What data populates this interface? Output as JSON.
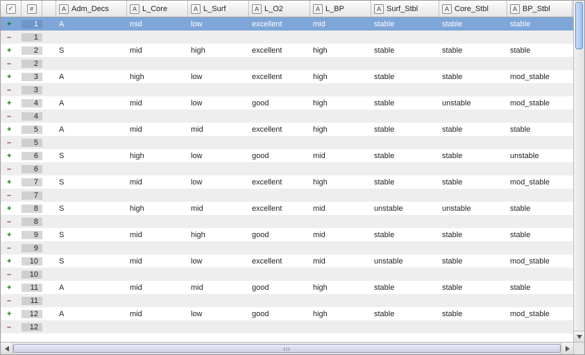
{
  "columns": {
    "adm": "Adm_Decs",
    "lcore": "L_Core",
    "lsurf": "L_Surf",
    "lo2": "L_O2",
    "lbp": "L_BP",
    "surfs": "Surf_Stbl",
    "cores": "Core_Stbl",
    "bps": "BP_Stbl"
  },
  "header_icons": {
    "check": "✓",
    "hash": "#",
    "text": "A"
  },
  "rows": [
    {
      "n": 1,
      "kind": "plus",
      "selected": true,
      "v": [
        "A",
        "mid",
        "low",
        "excellent",
        "mid",
        "stable",
        "stable",
        "stable"
      ]
    },
    {
      "n": 1,
      "kind": "minus",
      "selected": false,
      "v": [
        "",
        "",
        "",
        "",
        "",
        "",
        "",
        ""
      ]
    },
    {
      "n": 2,
      "kind": "plus",
      "selected": false,
      "v": [
        "S",
        "mid",
        "high",
        "excellent",
        "high",
        "stable",
        "stable",
        "stable"
      ]
    },
    {
      "n": 2,
      "kind": "minus",
      "selected": false,
      "v": [
        "",
        "",
        "",
        "",
        "",
        "",
        "",
        ""
      ]
    },
    {
      "n": 3,
      "kind": "plus",
      "selected": false,
      "v": [
        "A",
        "high",
        "low",
        "excellent",
        "high",
        "stable",
        "stable",
        "mod_stable"
      ]
    },
    {
      "n": 3,
      "kind": "minus",
      "selected": false,
      "v": [
        "",
        "",
        "",
        "",
        "",
        "",
        "",
        ""
      ]
    },
    {
      "n": 4,
      "kind": "plus",
      "selected": false,
      "v": [
        "A",
        "mid",
        "low",
        "good",
        "high",
        "stable",
        "unstable",
        "mod_stable"
      ]
    },
    {
      "n": 4,
      "kind": "minus",
      "selected": false,
      "v": [
        "",
        "",
        "",
        "",
        "",
        "",
        "",
        ""
      ]
    },
    {
      "n": 5,
      "kind": "plus",
      "selected": false,
      "v": [
        "A",
        "mid",
        "mid",
        "excellent",
        "high",
        "stable",
        "stable",
        "stable"
      ]
    },
    {
      "n": 5,
      "kind": "minus",
      "selected": false,
      "v": [
        "",
        "",
        "",
        "",
        "",
        "",
        "",
        ""
      ]
    },
    {
      "n": 6,
      "kind": "plus",
      "selected": false,
      "v": [
        "S",
        "high",
        "low",
        "good",
        "mid",
        "stable",
        "stable",
        "unstable"
      ]
    },
    {
      "n": 6,
      "kind": "minus",
      "selected": false,
      "v": [
        "",
        "",
        "",
        "",
        "",
        "",
        "",
        ""
      ]
    },
    {
      "n": 7,
      "kind": "plus",
      "selected": false,
      "v": [
        "S",
        "mid",
        "low",
        "excellent",
        "high",
        "stable",
        "stable",
        "mod_stable"
      ]
    },
    {
      "n": 7,
      "kind": "minus",
      "selected": false,
      "v": [
        "",
        "",
        "",
        "",
        "",
        "",
        "",
        ""
      ]
    },
    {
      "n": 8,
      "kind": "plus",
      "selected": false,
      "v": [
        "S",
        "high",
        "mid",
        "excellent",
        "mid",
        "unstable",
        "unstable",
        "stable"
      ]
    },
    {
      "n": 8,
      "kind": "minus",
      "selected": false,
      "v": [
        "",
        "",
        "",
        "",
        "",
        "",
        "",
        ""
      ]
    },
    {
      "n": 9,
      "kind": "plus",
      "selected": false,
      "v": [
        "S",
        "mid",
        "high",
        "good",
        "mid",
        "stable",
        "stable",
        "stable"
      ]
    },
    {
      "n": 9,
      "kind": "minus",
      "selected": false,
      "v": [
        "",
        "",
        "",
        "",
        "",
        "",
        "",
        ""
      ]
    },
    {
      "n": 10,
      "kind": "plus",
      "selected": false,
      "v": [
        "S",
        "mid",
        "low",
        "excellent",
        "mid",
        "unstable",
        "stable",
        "mod_stable"
      ]
    },
    {
      "n": 10,
      "kind": "minus",
      "selected": false,
      "v": [
        "",
        "",
        "",
        "",
        "",
        "",
        "",
        ""
      ]
    },
    {
      "n": 11,
      "kind": "plus",
      "selected": false,
      "v": [
        "A",
        "mid",
        "mid",
        "good",
        "high",
        "stable",
        "stable",
        "stable"
      ]
    },
    {
      "n": 11,
      "kind": "minus",
      "selected": false,
      "v": [
        "",
        "",
        "",
        "",
        "",
        "",
        "",
        ""
      ]
    },
    {
      "n": 12,
      "kind": "plus",
      "selected": false,
      "v": [
        "A",
        "mid",
        "low",
        "good",
        "high",
        "stable",
        "stable",
        "mod_stable"
      ]
    },
    {
      "n": 12,
      "kind": "minus",
      "selected": false,
      "v": [
        "",
        "",
        "",
        "",
        "",
        "",
        "",
        ""
      ]
    }
  ],
  "scroll": {
    "hthumb_grip": "ııı"
  }
}
